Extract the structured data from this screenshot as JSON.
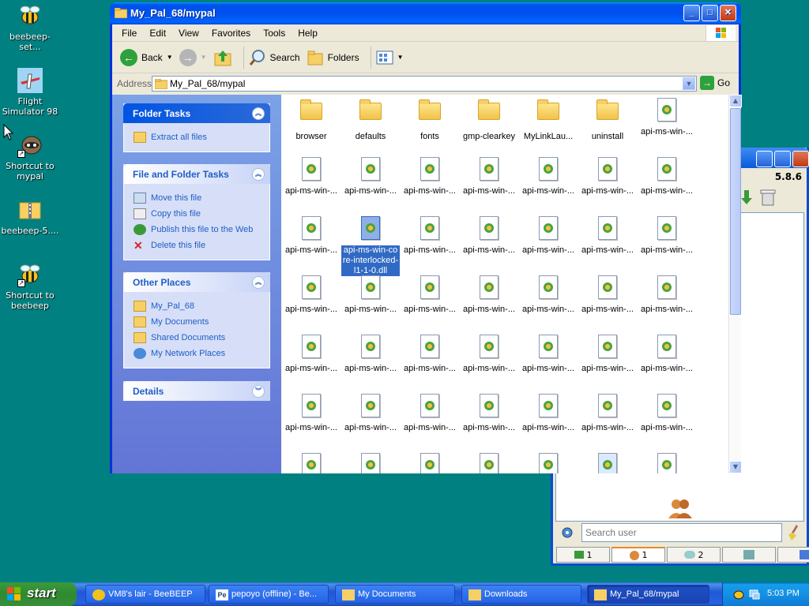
{
  "desktop": {
    "icons": [
      {
        "label": "beebeep-set...",
        "icon": "bee-icon"
      },
      {
        "label": "Flight Simulator 98",
        "icon": "airplane-icon"
      },
      {
        "label": "Shortcut to mypal",
        "icon": "raccoon-icon"
      },
      {
        "label": "beebeep-5....",
        "icon": "zip-folder-icon"
      },
      {
        "label": "Shortcut to beebeep",
        "icon": "bee-icon"
      }
    ]
  },
  "explorer": {
    "title": "My_Pal_68/mypal",
    "menu": [
      "File",
      "Edit",
      "View",
      "Favorites",
      "Tools",
      "Help"
    ],
    "toolbar": {
      "back": "Back",
      "search": "Search",
      "folders": "Folders"
    },
    "address": {
      "label": "Address",
      "value": "My_Pal_68/mypal",
      "go": "Go"
    },
    "folder_tasks": {
      "title": "Folder Tasks",
      "items": [
        "Extract all files"
      ]
    },
    "file_tasks": {
      "title": "File and Folder Tasks",
      "items": [
        "Move this file",
        "Copy this file",
        "Publish this file to the Web",
        "Delete this file"
      ]
    },
    "other_places": {
      "title": "Other Places",
      "items": [
        "My_Pal_68",
        "My Documents",
        "Shared Documents",
        "My Network Places"
      ]
    },
    "details": {
      "title": "Details"
    },
    "files": {
      "row0": [
        "browser",
        "defaults",
        "fonts",
        "gmp-clearkey",
        "MyLinkLau...",
        "uninstall",
        "api-ms-win-..."
      ],
      "dll_label": "api-ms-win-...",
      "selected_label": "api-ms-win-core-interlocked-l1-1-0.dll"
    }
  },
  "beebeep": {
    "version": "5.8.6",
    "search_placeholder": "Search user",
    "tabs": [
      "1",
      "1",
      "2",
      "",
      ""
    ]
  },
  "taskbar": {
    "start": "start",
    "items": [
      "VM8's lair - BeeBEEP",
      "pepoyo (offline) - Be...",
      "My Documents",
      "Downloads",
      "My_Pal_68/mypal"
    ],
    "clock": "5:03 PM"
  },
  "colors": {
    "desktop": "#008080",
    "taskbar": "#2157d7",
    "title_blue": "#0054e3",
    "start_green": "#3c9a3c",
    "selection": "#316ac5"
  }
}
